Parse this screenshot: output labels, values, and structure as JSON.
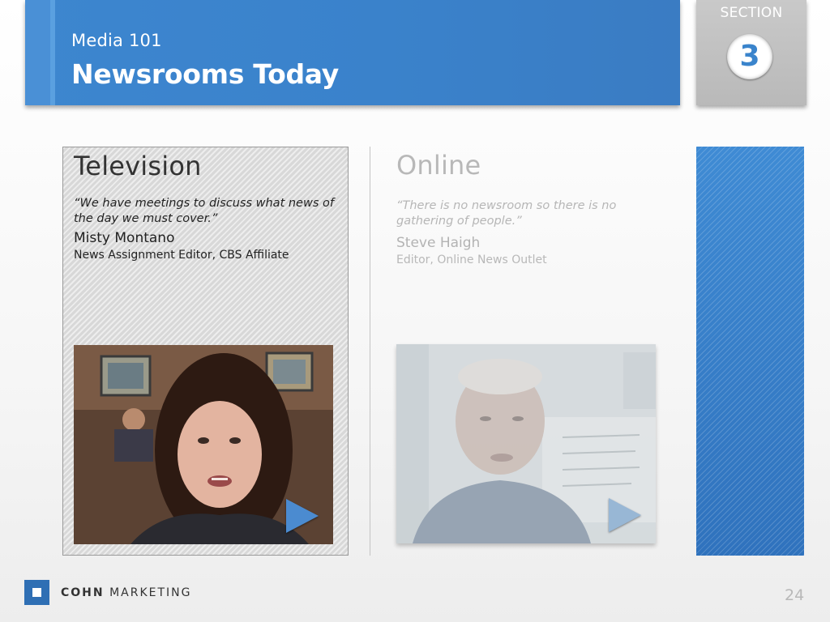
{
  "header": {
    "subtitle": "Media 101",
    "title": "Newsrooms Today"
  },
  "section": {
    "label": "SECTION",
    "number": "3"
  },
  "cards": {
    "television": {
      "heading": "Television",
      "quote": "“We have meetings to discuss what news of the day we must cover.”",
      "name": "Misty Montano",
      "role": "News Assignment Editor, CBS Affiliate"
    },
    "online": {
      "heading": "Online",
      "quote": "“There is no newsroom so there is no gathering of people.”",
      "name": "Steve Haigh",
      "role": "Editor, Online News Outlet"
    }
  },
  "footer": {
    "brand_bold": "COHN",
    "brand_rest": "MARKETING",
    "page_number": "24"
  },
  "colors": {
    "accent": "#3a84cc",
    "panel": "#2f72bd"
  }
}
